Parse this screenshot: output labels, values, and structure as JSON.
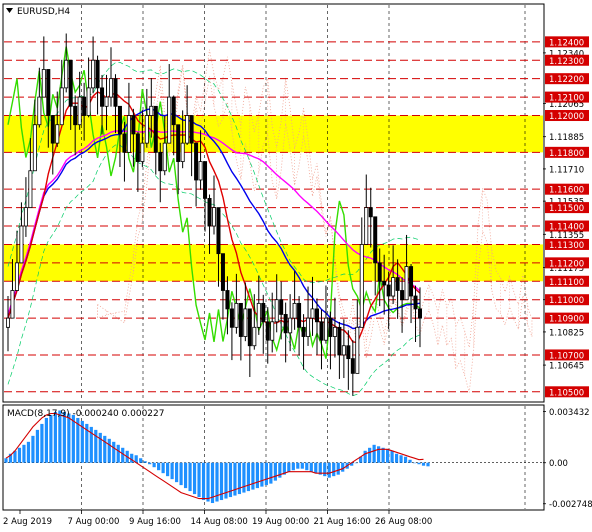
{
  "chart_data": {
    "type": "candlestick",
    "title": "EURUSD,H4",
    "price_axis": {
      "range": [
        1.1045,
        1.126
      ],
      "labels": [
        "1.12340",
        "1.12065",
        "1.11885",
        "1.11710",
        "1.11535",
        "1.11355",
        "1.11175",
        "1.11000",
        "1.10825",
        "1.10645"
      ],
      "label_values": [
        1.1234,
        1.12065,
        1.11885,
        1.1171,
        1.11535,
        1.11355,
        1.11175,
        1.11,
        1.10825,
        1.10645
      ]
    },
    "resistance_support_levels": {
      "values": [
        1.124,
        1.123,
        1.122,
        1.121,
        1.12,
        1.118,
        1.116,
        1.115,
        1.114,
        1.113,
        1.112,
        1.111,
        1.11,
        1.109,
        1.107,
        1.105
      ],
      "labels": [
        "1.12400",
        "1.12300",
        "1.12200",
        "1.12100",
        "1.12000",
        "1.11800",
        "1.11600",
        "1.11500",
        "1.11400",
        "1.11300",
        "1.11200",
        "1.11100",
        "1.11000",
        "1.10900",
        "1.10700",
        "1.10500"
      ],
      "color": "#d40000"
    },
    "highlight_zones": [
      {
        "from": 1.118,
        "to": 1.12,
        "color": "#ffff00"
      },
      {
        "from": 1.111,
        "to": 1.113,
        "color": "#ffff00"
      }
    ],
    "x_labels": [
      "2 Aug 2019",
      "7 Aug 00:00",
      "9 Aug 16:00",
      "14 Aug 08:00",
      "19 Aug 00:00",
      "21 Aug 16:00",
      "26 Aug 08:00"
    ],
    "x_grid_at_labels": [
      1,
      2,
      3,
      4,
      5,
      6
    ],
    "macd": {
      "label": "MACD(8,17,9) -0.000240 0.000227",
      "range": [
        -0.0031,
        0.0038
      ],
      "labels": [
        "0.003432",
        "0.00",
        "-0.002748"
      ],
      "label_values": [
        0.003432,
        0.0,
        -0.002748
      ],
      "histogram": [
        0.0003,
        0.0006,
        0.0008,
        0.001,
        0.0012,
        0.0014,
        0.0018,
        0.0022,
        0.0026,
        0.003,
        0.0032,
        0.0034,
        0.0035,
        0.0034,
        0.0033,
        0.0032,
        0.003,
        0.0028,
        0.0026,
        0.0024,
        0.0022,
        0.002,
        0.0018,
        0.0016,
        0.0014,
        0.0012,
        0.001,
        0.0008,
        0.0006,
        0.0005,
        0.0003,
        0.0001,
        -0.0001,
        -0.0003,
        -0.0005,
        -0.0007,
        -0.0009,
        -0.0011,
        -0.0013,
        -0.0015,
        -0.0017,
        -0.0019,
        -0.0021,
        -0.0023,
        -0.0025,
        -0.0026,
        -0.0027,
        -0.0026,
        -0.0025,
        -0.0024,
        -0.0023,
        -0.0022,
        -0.0021,
        -0.002,
        -0.0019,
        -0.0018,
        -0.0017,
        -0.0016,
        -0.0015,
        -0.0014,
        -0.0012,
        -0.001,
        -0.0008,
        -0.0006,
        -0.0005,
        -0.0004,
        -0.0004,
        -0.0005,
        -0.0006,
        -0.0007,
        -0.0008,
        -0.0009,
        -0.001,
        -0.0009,
        -0.0008,
        -0.0006,
        -0.0004,
        -0.0002,
        0.0,
        0.0004,
        0.0008,
        0.001,
        0.0012,
        0.0011,
        0.001,
        0.0009,
        0.0008,
        0.0006,
        0.0005,
        0.0004,
        0.0002,
        0.0,
        -0.0001,
        -0.0002,
        -0.00024
      ],
      "signal": [
        0.0003,
        0.0005,
        0.0008,
        0.0012,
        0.0016,
        0.002,
        0.0024,
        0.0027,
        0.003,
        0.0032,
        0.0033,
        0.0033,
        0.0032,
        0.0031,
        0.003,
        0.0028,
        0.0026,
        0.0024,
        0.0022,
        0.002,
        0.0018,
        0.0016,
        0.0014,
        0.0012,
        0.001,
        0.0008,
        0.0006,
        0.0004,
        0.0002,
        0.0,
        -0.0002,
        -0.0004,
        -0.0006,
        -0.0008,
        -0.001,
        -0.0012,
        -0.0014,
        -0.0016,
        -0.0018,
        -0.002,
        -0.0021,
        -0.0022,
        -0.0023,
        -0.0024,
        -0.0024,
        -0.0024,
        -0.0023,
        -0.0022,
        -0.0021,
        -0.002,
        -0.0019,
        -0.0018,
        -0.0017,
        -0.0016,
        -0.0015,
        -0.0014,
        -0.0013,
        -0.0012,
        -0.0011,
        -0.001,
        -0.0009,
        -0.0008,
        -0.0007,
        -0.0006,
        -0.0006,
        -0.0006,
        -0.0006,
        -0.0006,
        -0.0006,
        -0.0007,
        -0.0007,
        -0.0007,
        -0.0007,
        -0.0006,
        -0.0005,
        -0.0004,
        -0.0002,
        0.0,
        0.0002,
        0.0004,
        0.0006,
        0.0007,
        0.0008,
        0.0009,
        0.0009,
        0.0009,
        0.0008,
        0.0007,
        0.0006,
        0.0005,
        0.0004,
        0.0003,
        0.0002,
        0.00023
      ],
      "hist_color": "#1e90ff",
      "signal_color": "#d40000"
    },
    "candles_close": [
      1.109,
      1.1105,
      1.112,
      1.114,
      1.115,
      1.117,
      1.1195,
      1.121,
      1.1225,
      1.12,
      1.1185,
      1.1195,
      1.1215,
      1.123,
      1.1205,
      1.1195,
      1.121,
      1.12,
      1.1215,
      1.123,
      1.1215,
      1.1205,
      1.121,
      1.122,
      1.1205,
      1.119,
      1.118,
      1.12,
      1.119,
      1.1175,
      1.1185,
      1.12,
      1.1205,
      1.118,
      1.117,
      1.1185,
      1.121,
      1.1195,
      1.1175,
      1.1185,
      1.12,
      1.1185,
      1.1165,
      1.1175,
      1.1155,
      1.114,
      1.115,
      1.1125,
      1.1105,
      1.1095,
      1.1085,
      1.1098,
      1.108,
      1.1095,
      1.1075,
      1.1085,
      1.1098,
      1.1088,
      1.1078,
      1.1088,
      1.11,
      1.1092,
      1.1082,
      1.109,
      1.1098,
      1.1085,
      1.108,
      1.109,
      1.1095,
      1.1088,
      1.1078,
      1.109,
      1.108,
      1.1085,
      1.107,
      1.1075,
      1.1068,
      1.106,
      1.1085,
      1.113,
      1.115,
      1.1145,
      1.112,
      1.111,
      1.1108,
      1.1102,
      1.1112,
      1.1105,
      1.11,
      1.1118,
      1.1102,
      1.1095,
      1.109
    ],
    "colors": {
      "candle": "#000000",
      "red_line": "#e00000",
      "blue_line": "#0000ee",
      "magenta_line": "#ff00ff",
      "green_line": "#33dd00",
      "band_line": "#00cc66",
      "cloud": "#f0a090"
    }
  }
}
